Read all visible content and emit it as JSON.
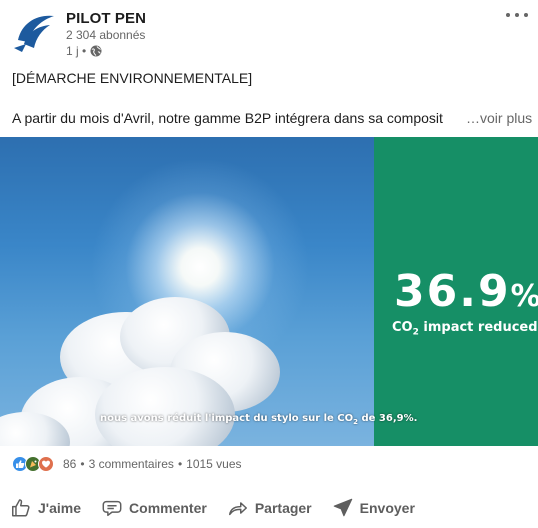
{
  "post": {
    "company": "PILOT PEN",
    "followers": "2 304 abonnés",
    "time": "1 j •",
    "text_line1": "[DÉMARCHE ENVIRONNEMENTALE]",
    "text_line2": "A partir du mois d'Avril, notre gamme B2P intégrera dans sa composit",
    "see_more": "…voir plus"
  },
  "media": {
    "stat_value": "36.9",
    "stat_unit": "%",
    "stat_label_co": "CO",
    "stat_label_sub": "2",
    "stat_label_rest": " impact reduced",
    "caption_before": "nous avons réduit l'impact du stylo sur le CO",
    "caption_sub": "2",
    "caption_after": " de 36,9%."
  },
  "social": {
    "reactions_count": "86",
    "comments": "3 commentaires",
    "views": "1015 vues",
    "separator": "•"
  },
  "actions": {
    "like": "J'aime",
    "comment": "Commenter",
    "share": "Partager",
    "send": "Envoyer"
  },
  "colors": {
    "green_panel": "#168f66",
    "brand_blue": "#1d5a9e",
    "like_blue": "#378fe9",
    "celebrate_green": "#44712e",
    "love_red": "#df704d"
  },
  "icons": [
    "pilot-logo",
    "globe-icon",
    "more-icon",
    "like-reaction-icon",
    "celebrate-reaction-icon",
    "love-reaction-icon",
    "like-icon",
    "comment-icon",
    "share-icon",
    "send-icon"
  ]
}
